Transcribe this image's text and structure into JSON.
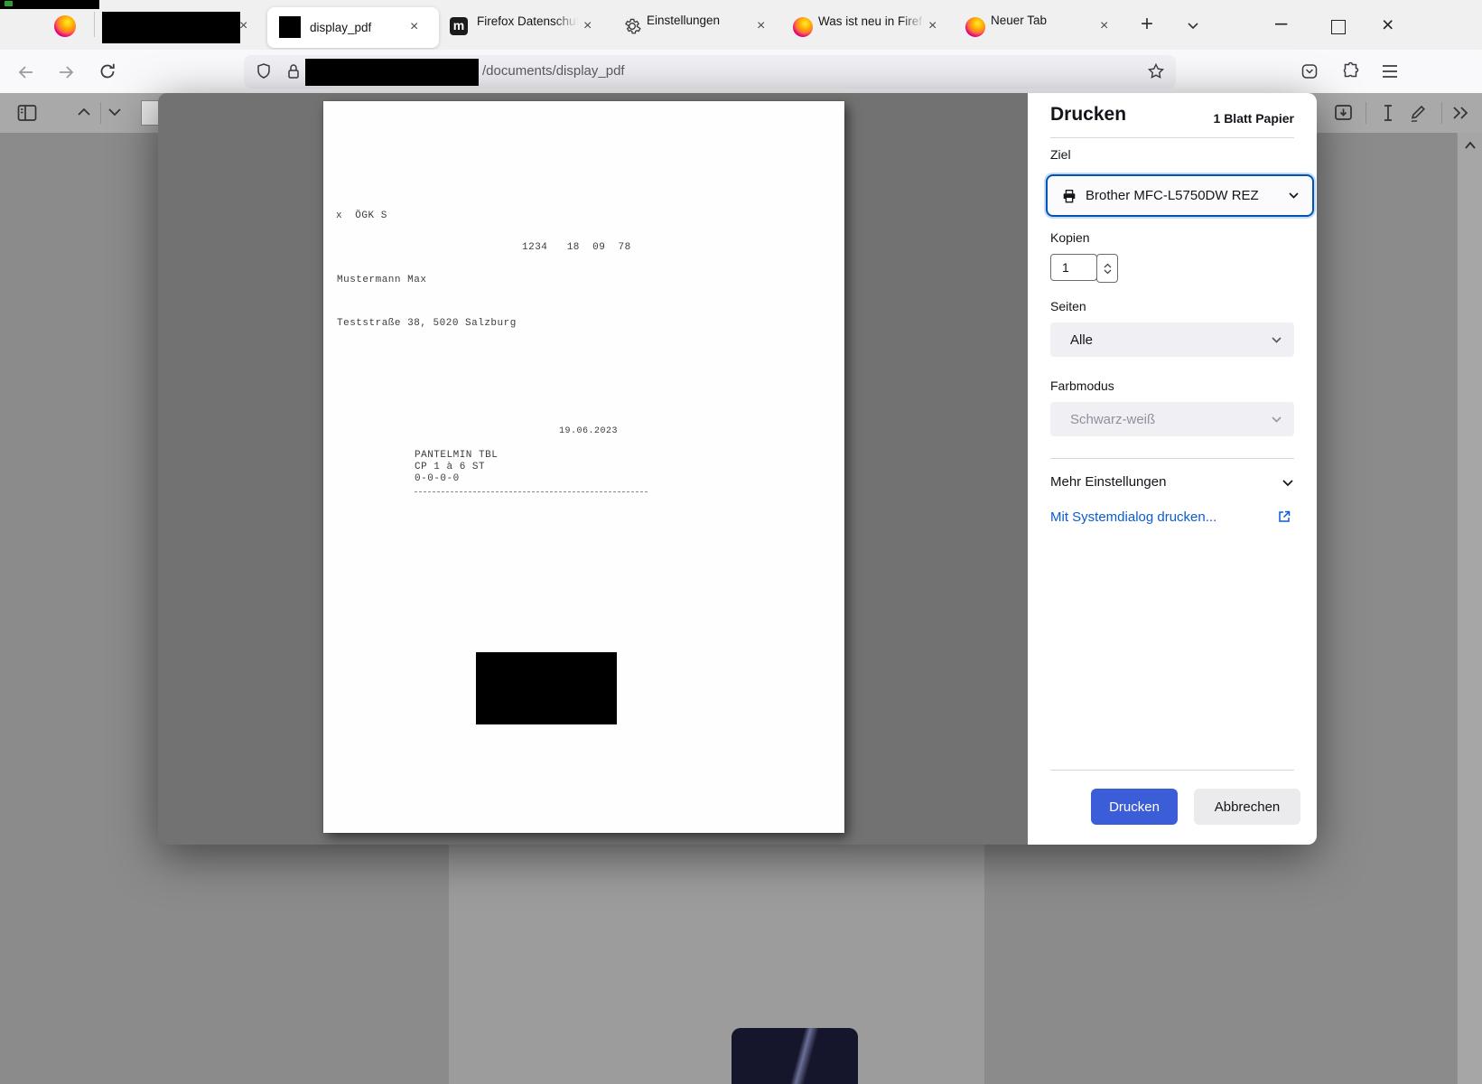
{
  "browser": {
    "tabs": [
      {
        "label": "",
        "type": "pinned-firefox"
      },
      {
        "label": "",
        "type": "redacted"
      },
      {
        "label": "display_pdf",
        "type": "active"
      },
      {
        "label": "Firefox Datenschut",
        "type": "normal"
      },
      {
        "label": "Einstellungen",
        "type": "normal"
      },
      {
        "label": "Was ist neu in Firef",
        "type": "normal"
      },
      {
        "label": "Neuer Tab",
        "type": "normal"
      }
    ],
    "new_tab_button": "+",
    "window_controls": {
      "minimize": "–",
      "close": "×"
    },
    "close_glyph": "×",
    "url_path": "/documents/display_pdf"
  },
  "document": {
    "checkbox_line": "x  ÖGK S",
    "insurance_number": "1234   18  09  78",
    "patient_name": "Mustermann Max",
    "address": "Teststraße 38, 5020 Salzburg",
    "date": "19.06.2023",
    "medication": "PANTELMIN TBL",
    "pack_size": "CP 1 à 6 ST",
    "dosage_scheme": "0-0-0-0"
  },
  "print_dialog": {
    "title": "Drucken",
    "sheet_info": "1 Blatt Papier",
    "destination": {
      "label": "Ziel",
      "value": "Brother MFC-L5750DW REZ"
    },
    "copies": {
      "label": "Kopien",
      "value": "1"
    },
    "pages": {
      "label": "Seiten",
      "value": "Alle"
    },
    "color_mode": {
      "label": "Farbmodus",
      "value": "Schwarz-weiß"
    },
    "more_settings": "Mehr Einstellungen",
    "system_dialog_link": "Mit Systemdialog drucken...",
    "print_button": "Drucken",
    "cancel_button": "Abbrechen"
  },
  "colors": {
    "primary_button": "#3b5dd8",
    "link_blue": "#0b5cd0",
    "printer_focus_border": "#0553b1",
    "tabbar_bg": "#f0f0f0",
    "dim_overlay_gray": "#8b8b8b"
  }
}
